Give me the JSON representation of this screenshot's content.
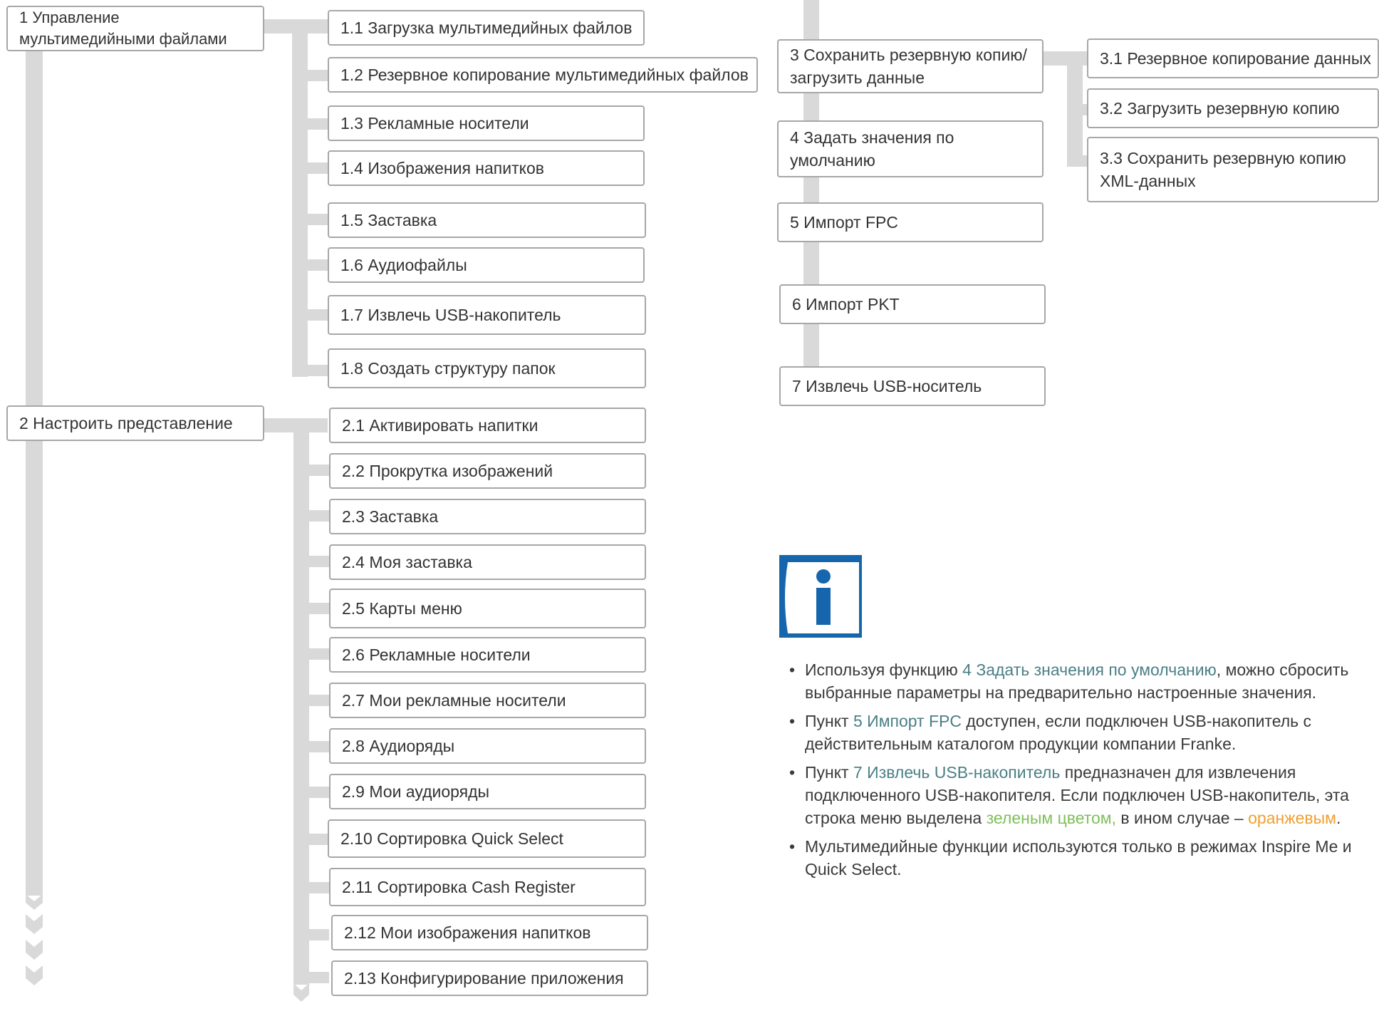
{
  "menu": {
    "n1": "1 Управление мультимедийными файлами",
    "n1_items": [
      "1.1 Загрузка мультимедийных файлов",
      "1.2 Резервное копирование мультимедийных файлов",
      "1.3 Рекламные носители",
      "1.4 Изображения напитков",
      "1.5 Заставка",
      "1.6 Аудиофайлы",
      "1.7 Извлечь USB-накопитель",
      "1.8 Создать структуру папок"
    ],
    "n2": "2 Настроить представление",
    "n2_items": [
      "2.1 Активировать напитки",
      "2.2 Прокрутка изображений",
      "2.3 Заставка",
      "2.4 Моя заставка",
      "2.5 Карты меню",
      "2.6 Рекламные носители",
      "2.7 Мои рекламные носители",
      "2.8 Аудиоряды",
      "2.9 Мои аудиоряды",
      "2.10 Сортировка Quick Select",
      "2.11 Сортировка Cash Register",
      "2.12 Мои изображения напитков",
      "2.13 Конфигурирование приложения"
    ],
    "n3": "3 Сохранить резервную копию/ загрузить данные",
    "n3_items": [
      "3.1 Резервное копирование данных",
      "3.2 Загрузить резервную копию",
      "3.3 Сохранить резервную копию XML-данных"
    ],
    "n4": "4 Задать значения по умолчанию",
    "n5": "5 Импорт FPC",
    "n6": "6 Импорт PKT",
    "n7": "7 Извлечь USB-носитель"
  },
  "notes": {
    "b1_pre": "Используя функцию ",
    "b1_ref": "4 Задать значения по умолчанию",
    "b1_post": ", можно сбросить выбранные параметры на предварительно настроенные значения.",
    "b2_pre": "Пункт ",
    "b2_ref": "5 Импорт FPC",
    "b2_post": " доступен, если подключен USB-накопитель с действительным каталогом продукции компании Franke.",
    "b3_pre": "Пункт ",
    "b3_ref": "7 Извлечь USB-накопитель",
    "b3_mid": " предназначен для извлечения подключенного USB-накопителя. Если подключен USB-накопитель, эта строка меню выделена ",
    "b3_green": "зеленым цветом,",
    "b3_mid2": " в ином случае – ",
    "b3_orange": "оранжевым",
    "b3_end": ".",
    "b4": "Мультимедийные функции используются только в режимах Inspire Me и Quick Select."
  },
  "colors": {
    "connector": "#d9d9d9",
    "border": "#a7a7a7",
    "info_blue": "#1566ad",
    "reference_text": "#4a7f86",
    "green_text": "#7fbf5a",
    "orange_text": "#f0a030"
  },
  "icons": [
    "info-icon",
    "chevron-down-icon"
  ]
}
